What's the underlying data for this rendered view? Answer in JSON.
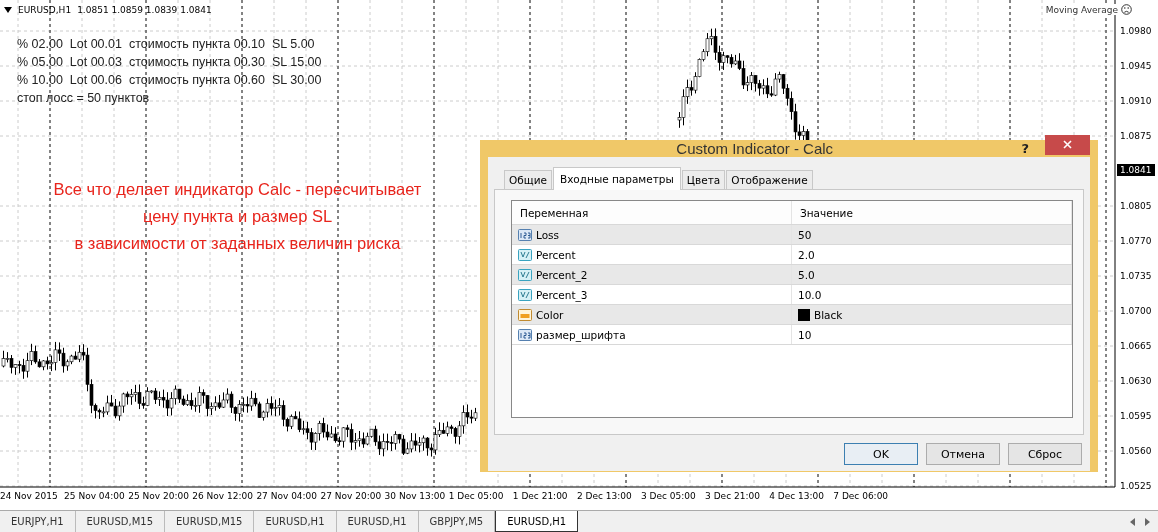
{
  "chart": {
    "header": {
      "symbol": "EURUSD,H1",
      "ohlc": "1.0851 1.0859 1.0839 1.0841"
    },
    "info_lines": [
      "% 02.00  Lot 00.01  стоимость пункта 00.10  SL 5.00",
      "% 05.00  Lot 00.03  стоимость пункта 00.30  SL 15.00",
      "% 10.00  Lot 00.06  стоимость пункта 00.60  SL 30.00",
      "стоп лосс = 50 пунктов"
    ],
    "annotation_lines": [
      "Все что делает индикатор Calc - пересчитывает",
      "цену пункта и размер SL",
      "в зависимости от заданных величин риска"
    ],
    "indicator_label": "Moving Average",
    "price_ticks": [
      "1.0980",
      "1.0945",
      "1.0910",
      "1.0875",
      "1.0805",
      "1.0770",
      "1.0735",
      "1.0700",
      "1.0665",
      "1.0630",
      "1.0595",
      "1.0560",
      "1.0525"
    ],
    "current_price": "1.0841",
    "time_ticks": [
      "24 Nov 2015",
      "25 Nov 04:00",
      "25 Nov 20:00",
      "26 Nov 12:00",
      "27 Nov 04:00",
      "27 Nov 20:00",
      "30 Nov 13:00",
      "1 Dec 05:00",
      "1 Dec 21:00",
      "2 Dec 13:00",
      "3 Dec 05:00",
      "3 Dec 21:00",
      "4 Dec 13:00",
      "7 Dec 06:00"
    ]
  },
  "dialog": {
    "title": "Custom Indicator - Calc",
    "help": "?",
    "tabs": [
      {
        "label": "Общие",
        "selected": false
      },
      {
        "label": "Входные параметры",
        "selected": true
      },
      {
        "label": "Цвета",
        "selected": false
      },
      {
        "label": "Отображение",
        "selected": false
      }
    ],
    "columns": [
      "Переменная",
      "Значение"
    ],
    "rows": [
      {
        "kind": "integer",
        "name": "Loss",
        "value": "50"
      },
      {
        "kind": "double",
        "name": "Percent",
        "value": "2.0"
      },
      {
        "kind": "double",
        "name": "Percent_2",
        "value": "5.0"
      },
      {
        "kind": "double",
        "name": "Percent_3",
        "value": "10.0"
      },
      {
        "kind": "color",
        "name": "Color",
        "value": "Black",
        "color": "#000000"
      },
      {
        "kind": "integer",
        "name": "размер_шрифта",
        "value": "10"
      }
    ],
    "buttons": [
      {
        "label": "OK",
        "default": true
      },
      {
        "label": "Отмена",
        "default": false
      },
      {
        "label": "Сброс",
        "default": false
      }
    ]
  },
  "symbol_tabs": [
    {
      "label": "EURJPY,H1",
      "selected": false
    },
    {
      "label": "EURUSD,M15",
      "selected": false
    },
    {
      "label": "EURUSD,M15",
      "selected": false
    },
    {
      "label": "EURUSD,H1",
      "selected": false
    },
    {
      "label": "EURUSD,H1",
      "selected": false
    },
    {
      "label": "GBPJPY,M5",
      "selected": false
    },
    {
      "label": "EURUSD,H1",
      "selected": true
    }
  ]
}
